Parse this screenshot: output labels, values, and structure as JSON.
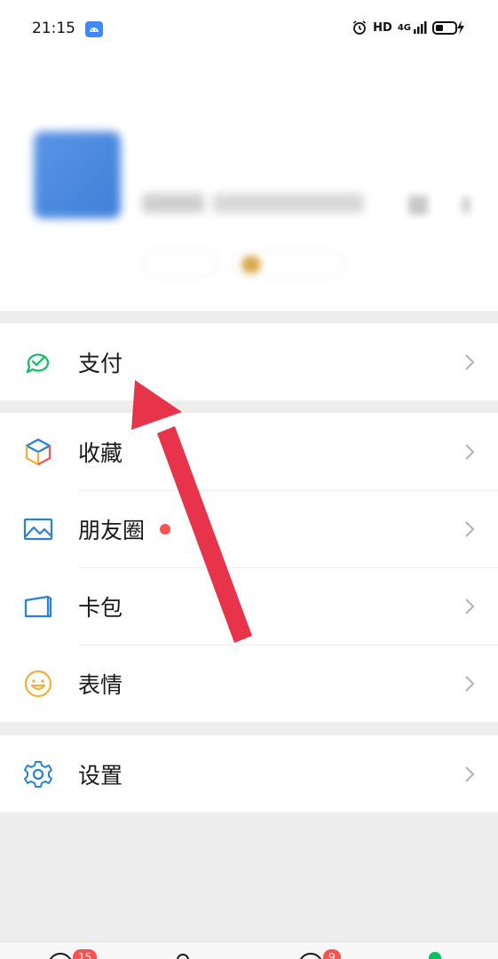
{
  "status_bar": {
    "time": "21:15",
    "network_label": "HD",
    "signal_label": "4G"
  },
  "profile": {
    "avatar": "blurred-avatar",
    "name": "",
    "wechat_id": ""
  },
  "menu_groups": [
    [
      {
        "label": "支付",
        "icon": "pay-icon",
        "color": "#07c160"
      }
    ],
    [
      {
        "label": "收藏",
        "icon": "favorites-icon",
        "color": "#f2b13a"
      },
      {
        "label": "朋友圈",
        "icon": "moments-icon",
        "color": "#2782d7",
        "has_dot": true
      },
      {
        "label": "卡包",
        "icon": "card-wallet-icon",
        "color": "#2782d7"
      },
      {
        "label": "表情",
        "icon": "sticker-icon",
        "color": "#f2b13a"
      }
    ],
    [
      {
        "label": "设置",
        "icon": "settings-icon",
        "color": "#2782d7"
      }
    ]
  ],
  "tab_bar": {
    "chats_badge": "15",
    "discover_badge": "9"
  },
  "annotation": {
    "arrow_color": "#e8344a"
  }
}
